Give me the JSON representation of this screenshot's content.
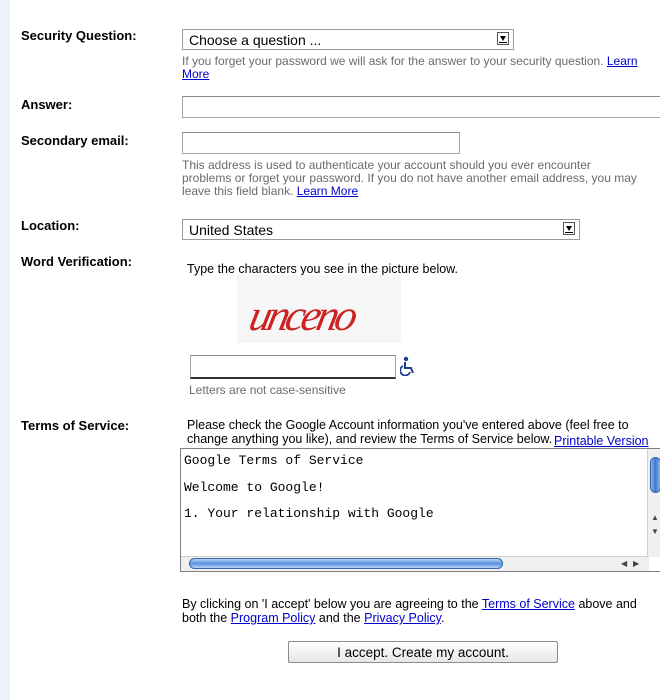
{
  "security_question": {
    "label": "Security Question:",
    "selected": "Choose a question ...",
    "hint": "If you forget your password we will ask for the answer to your security question.",
    "learn_more": "Learn More"
  },
  "answer": {
    "label": "Answer:",
    "value": ""
  },
  "secondary_email": {
    "label": "Secondary email:",
    "value": "",
    "hint": "This address is used to authenticate your account should you ever encounter problems or forget your password. If you do not have another email address, you may leave this field blank.",
    "learn_more": "Learn More"
  },
  "location": {
    "label": "Location:",
    "selected": "United States"
  },
  "word_verification": {
    "label": "Word Verification:",
    "instruction": "Type the characters you see in the picture below.",
    "captcha_text": "unceno",
    "value": "",
    "hint": "Letters are not case-sensitive",
    "accessibility_icon": "wheelchair-icon"
  },
  "terms": {
    "label": "Terms of Service:",
    "instruction": "Please check the Google Account information you've entered above (feel free to change anything you like), and review the Terms of Service below.",
    "printable": "Printable Version",
    "content_lines": [
      "Google Terms of Service",
      "Welcome to Google!",
      "1. Your relationship with Google"
    ],
    "agreement_prefix": "By clicking on 'I accept' below you are agreeing to the",
    "tos_link": "Terms of Service",
    "agreement_mid": "above and both the",
    "program_policy_link": "Program Policy",
    "agreement_and": "and the",
    "privacy_policy_link": "Privacy Policy",
    "agreement_end": "."
  },
  "accept_button": "I accept. Create my account.",
  "colors": {
    "link": "#0000cc",
    "hint": "#6b6b6b",
    "captcha": "#cc2222",
    "icon": "#1a3f8f"
  }
}
